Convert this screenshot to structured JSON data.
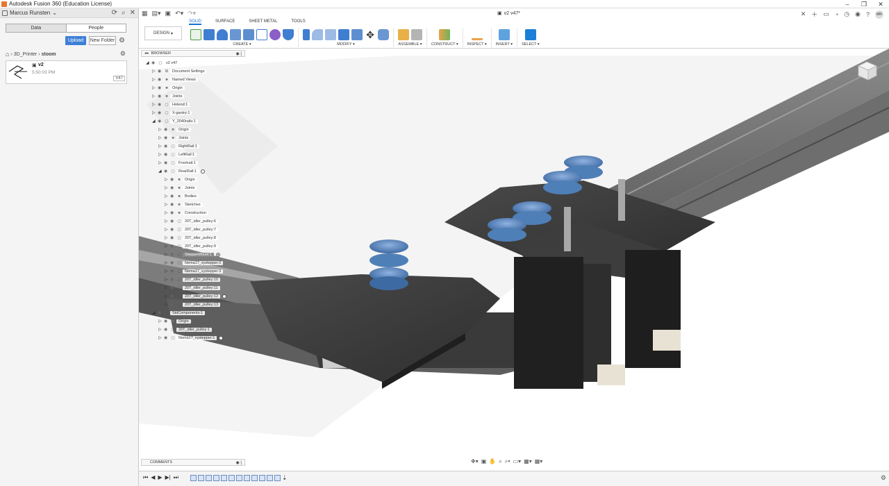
{
  "window": {
    "title": "Autodesk Fusion 360 (Education License)",
    "controls": [
      "–",
      "❐",
      "✕"
    ]
  },
  "data_panel": {
    "user": "Marcus Runsten",
    "tabs": [
      "Data",
      "People"
    ],
    "upload_label": "Upload",
    "new_folder_label": "New Folder",
    "breadcrumb": [
      "3D_Printer",
      "stoom"
    ],
    "file": {
      "name": "v2",
      "time": "5:50:03 PM",
      "version": "V47"
    }
  },
  "toolbar": {
    "document_tab": "v2 v47*",
    "avatar_initials": "MR",
    "workspace_tabs": [
      "SOLID",
      "SURFACE",
      "SHEET METAL",
      "TOOLS"
    ],
    "design_label": "DESIGN",
    "groups": [
      {
        "label": "CREATE",
        "count": 8
      },
      {
        "label": "MODIFY",
        "count": 8
      },
      {
        "label": "ASSEMBLE",
        "count": 2
      },
      {
        "label": "CONSTRUCT",
        "count": 1
      },
      {
        "label": "INSPECT",
        "count": 1
      },
      {
        "label": "INSERT",
        "count": 1
      },
      {
        "label": "SELECT",
        "count": 1
      }
    ]
  },
  "browser": {
    "title": "BROWSER",
    "items": [
      {
        "label": "v2 v47",
        "arrow": "◢",
        "indent": 0,
        "type": "doc"
      },
      {
        "label": "Document Settings",
        "arrow": "▷",
        "indent": 1,
        "type": "gear"
      },
      {
        "label": "Named Views",
        "arrow": "▷",
        "indent": 1,
        "type": "folder"
      },
      {
        "label": "Origin",
        "arrow": "▷",
        "indent": 1,
        "type": "folder"
      },
      {
        "label": "Joints",
        "arrow": "▷",
        "indent": 1,
        "type": "folder"
      },
      {
        "label": "Hotend:1",
        "arrow": "▷",
        "indent": 1,
        "type": "comp"
      },
      {
        "label": "X-gantry:1",
        "arrow": "▷",
        "indent": 1,
        "type": "comp"
      },
      {
        "label": "Y_2040rails:1",
        "arrow": "◢",
        "indent": 1,
        "type": "comp"
      },
      {
        "label": "Origin",
        "arrow": "▷",
        "indent": 2,
        "type": "folder"
      },
      {
        "label": "Joints",
        "arrow": "▷",
        "indent": 2,
        "type": "folder"
      },
      {
        "label": "RightRail:1",
        "arrow": "▷",
        "indent": 2,
        "type": "comp"
      },
      {
        "label": "LeftRail:1",
        "arrow": "▷",
        "indent": 2,
        "type": "comp"
      },
      {
        "label": "Frontrail:1",
        "arrow": "▷",
        "indent": 2,
        "type": "comp"
      },
      {
        "label": "RearRail:1",
        "arrow": "◢",
        "indent": 2,
        "type": "comp",
        "radio": "off"
      },
      {
        "label": "Origin",
        "arrow": "▷",
        "indent": 3,
        "type": "folder"
      },
      {
        "label": "Joints",
        "arrow": "▷",
        "indent": 3,
        "type": "folder"
      },
      {
        "label": "Bodies",
        "arrow": "▷",
        "indent": 3,
        "type": "folder"
      },
      {
        "label": "Sketches",
        "arrow": "▷",
        "indent": 3,
        "type": "folder"
      },
      {
        "label": "Construction",
        "arrow": "▷",
        "indent": 3,
        "type": "folder"
      },
      {
        "label": "20T_idler_pulley:6",
        "arrow": "▷",
        "indent": 3,
        "type": "comp"
      },
      {
        "label": "20T_idler_pulley:7",
        "arrow": "▷",
        "indent": 3,
        "type": "comp"
      },
      {
        "label": "20T_idler_pulley:8",
        "arrow": "▷",
        "indent": 3,
        "type": "comp"
      },
      {
        "label": "20T_idler_pulley:9",
        "arrow": "▷",
        "indent": 3,
        "type": "comp"
      },
      {
        "label": "StepperMount:1",
        "arrow": "▷",
        "indent": 3,
        "type": "comp",
        "selected": true,
        "radio": "on"
      },
      {
        "label": "Nema17_xystepper:2",
        "arrow": "▷",
        "indent": 3,
        "type": "comp"
      },
      {
        "label": "Nema17_xystepper:3",
        "arrow": "▷",
        "indent": 3,
        "type": "comp"
      },
      {
        "label": "20T_idler_pulley:10",
        "arrow": "▷",
        "indent": 3,
        "type": "comp"
      },
      {
        "label": "20T_idler_pulley:11",
        "arrow": "▷",
        "indent": 3,
        "type": "comp"
      },
      {
        "label": "20T_idler_pulley:12",
        "arrow": "▷",
        "indent": 3,
        "type": "comp",
        "radio": "off"
      },
      {
        "label": "20T_idler_pulley:13",
        "arrow": "▷",
        "indent": 3,
        "type": "comp"
      },
      {
        "label": "StdComponents:1",
        "arrow": "◢",
        "indent": 1,
        "type": "comp"
      },
      {
        "label": "Origin",
        "arrow": "▷",
        "indent": 2,
        "type": "folder"
      },
      {
        "label": "20T_idler_pulley:1",
        "arrow": "▷",
        "indent": 2,
        "type": "comp"
      },
      {
        "label": "Nema17_xystepper:1",
        "arrow": "▷",
        "indent": 2,
        "type": "comp",
        "radio": "off"
      }
    ]
  },
  "comments": {
    "title": "COMMENTS"
  },
  "colors": {
    "accent": "#1a6fd1",
    "upload": "#3e7fd6",
    "metal_dark": "#3c3c3c",
    "pulley_blue": "#4f7fb7"
  }
}
